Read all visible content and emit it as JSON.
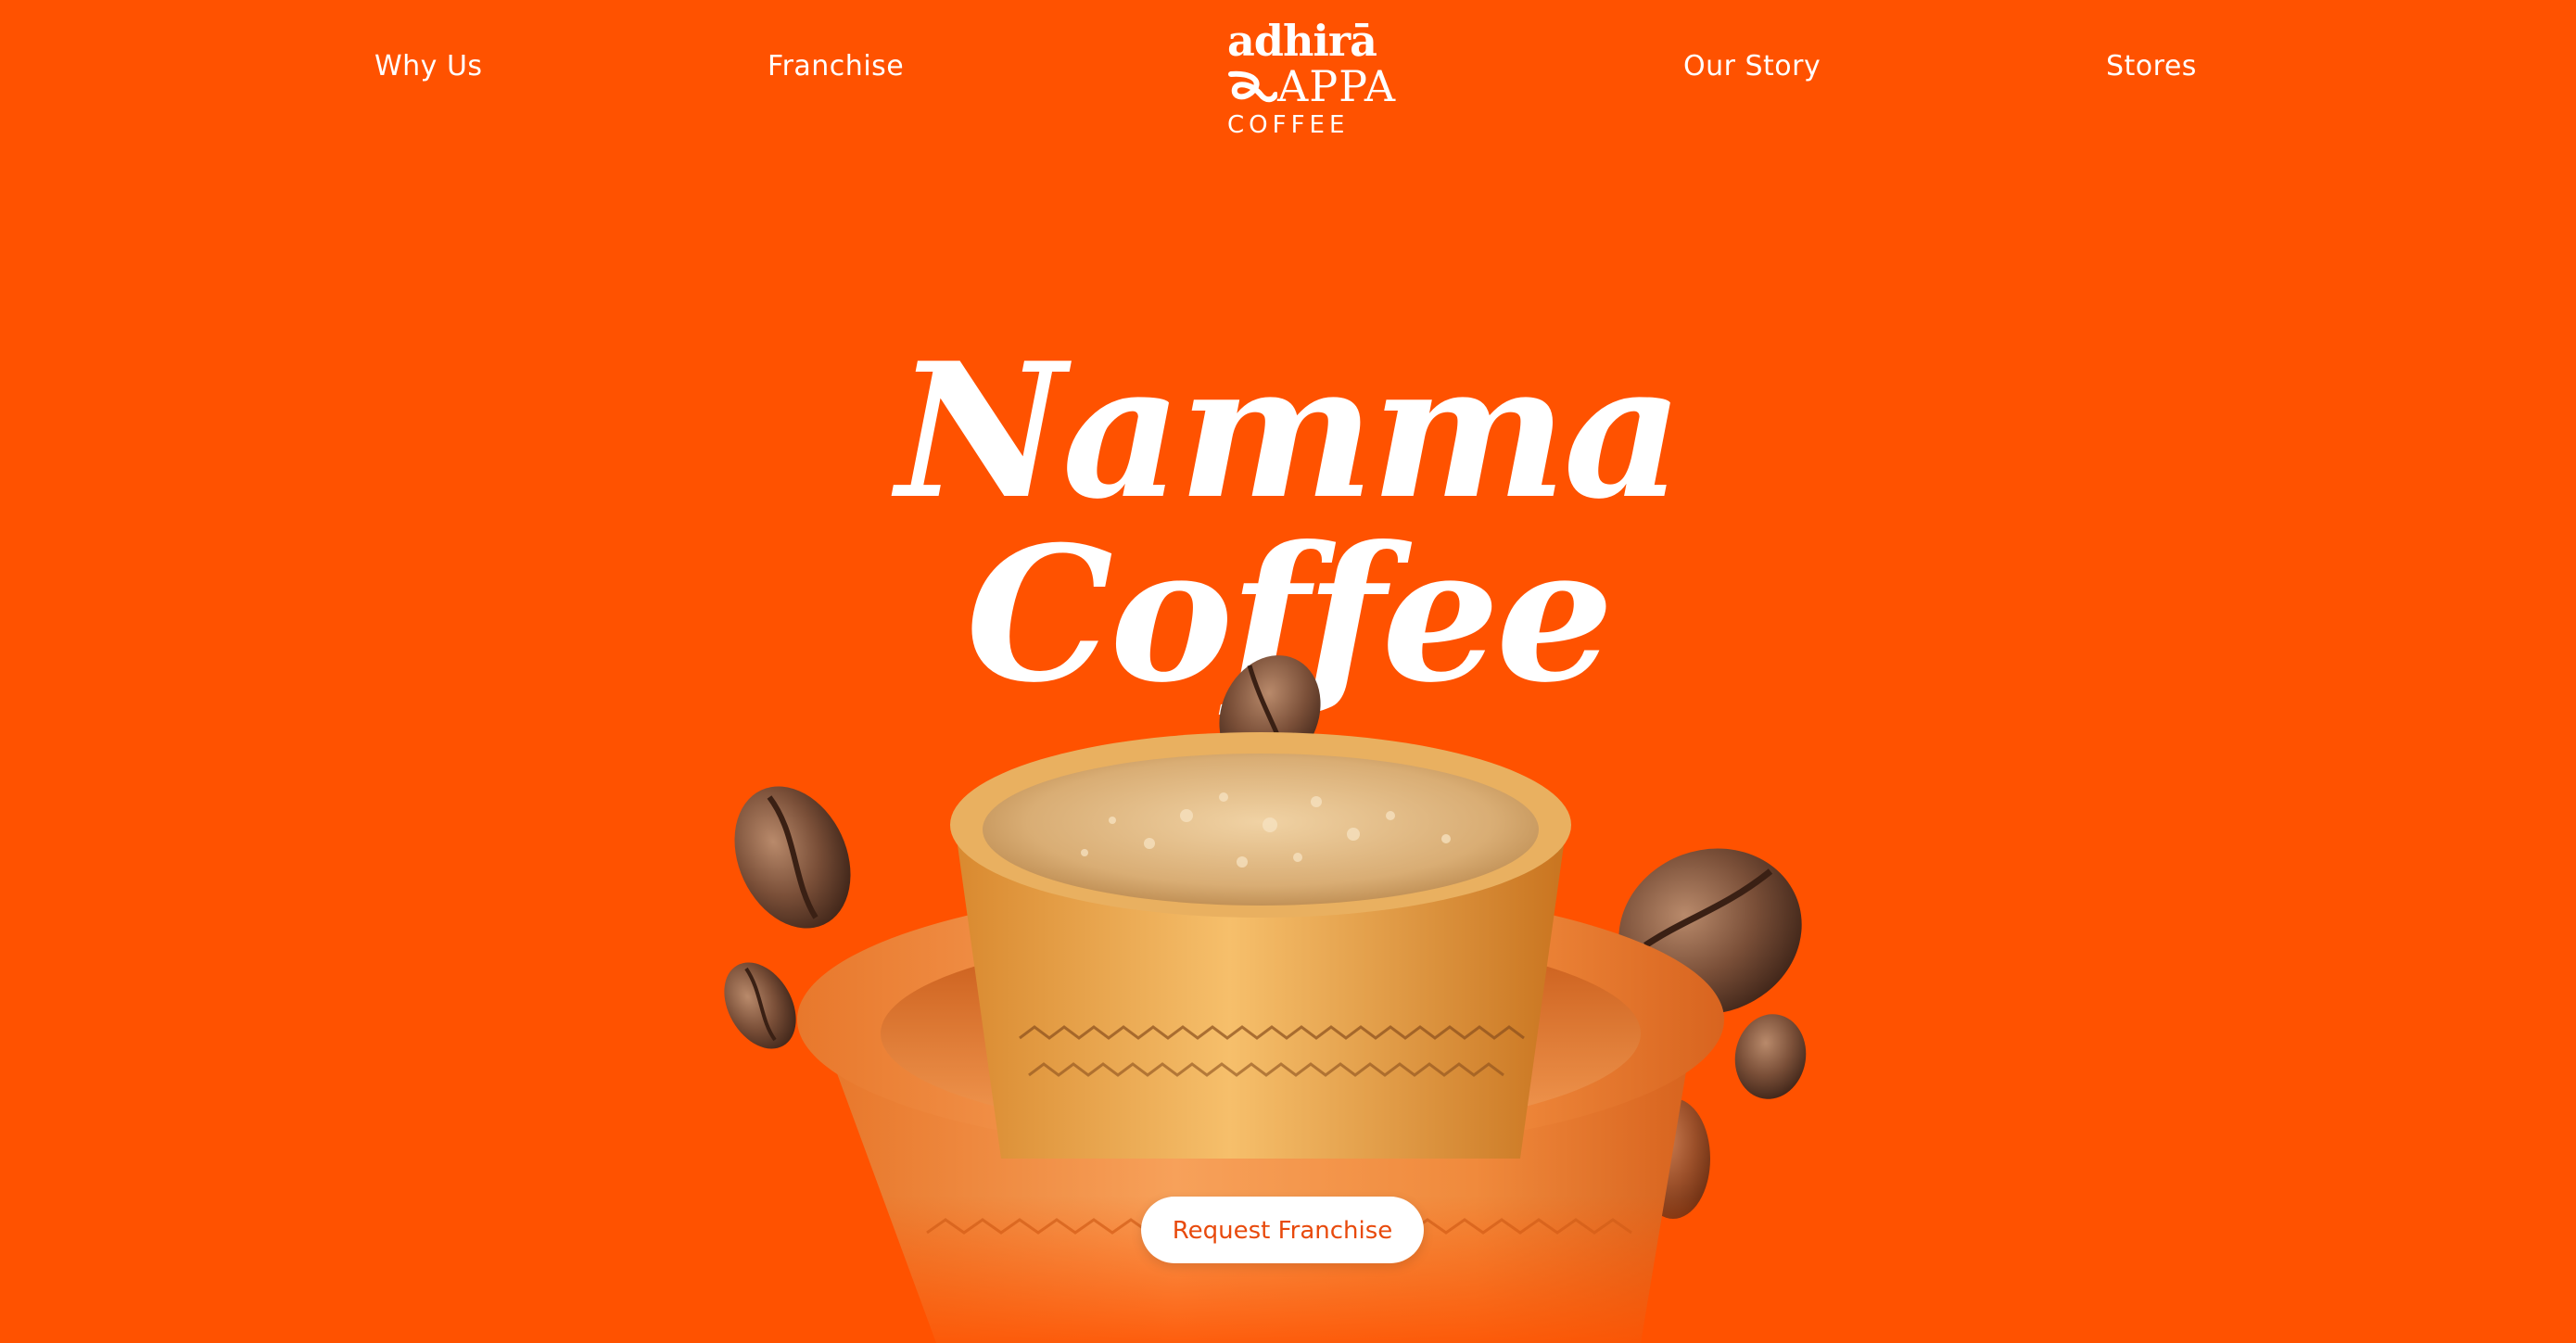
{
  "nav": {
    "items": [
      {
        "label": "Why Us"
      },
      {
        "label": "Franchise"
      },
      {
        "label": "Our Story"
      },
      {
        "label": "Stores"
      }
    ]
  },
  "logo": {
    "line1": "adhirā",
    "line2": "APPA",
    "line3": "COFFEE"
  },
  "hero": {
    "headline_line1": "Namma",
    "headline_line2": "Coffee",
    "cta_label": "Request Franchise"
  },
  "colors": {
    "background": "#ff5200",
    "text": "#ffffff",
    "cta_background": "#ffffff",
    "cta_text": "#e84a0c"
  },
  "icons": {
    "hero_image": "filter-coffee-tumbler-with-coffee-beans"
  }
}
